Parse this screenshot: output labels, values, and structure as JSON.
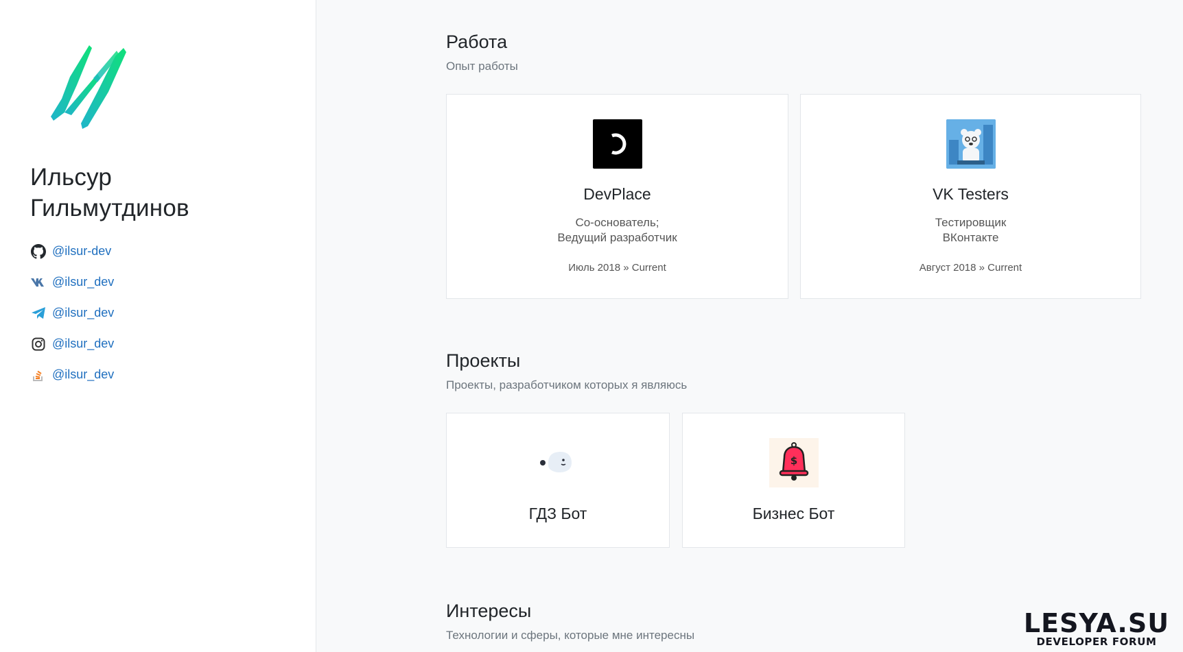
{
  "profile": {
    "logo_icon": "brush-stroke-logo",
    "name_line1": "Ильсур",
    "name_line2": "Гильмутдинов",
    "socials": [
      {
        "icon": "github-icon",
        "handle": "@ilsur-dev"
      },
      {
        "icon": "vk-icon",
        "handle": "@ilsur_dev"
      },
      {
        "icon": "telegram-icon",
        "handle": "@ilsur_dev"
      },
      {
        "icon": "instagram-icon",
        "handle": "@ilsur_dev"
      },
      {
        "icon": "stackoverflow-icon",
        "handle": "@ilsur_dev"
      }
    ]
  },
  "work": {
    "title": "Работа",
    "subtitle": "Опыт работы",
    "items": [
      {
        "name": "DevPlace",
        "role_line1": "Со-основатель;",
        "role_line2": "Ведущий разработчик",
        "dates": "Июль 2018 » Current"
      },
      {
        "name": "VK Testers",
        "role_line1": "Тестировщик",
        "role_line2": "ВКонтакте",
        "dates": "Август 2018 » Current"
      }
    ]
  },
  "projects": {
    "title": "Проекты",
    "subtitle": "Проекты, разработчиком которых я являюсь",
    "items": [
      {
        "name": "ГДЗ Бот"
      },
      {
        "name": "Бизнес Бот"
      }
    ]
  },
  "interests": {
    "title": "Интересы",
    "subtitle": "Технологии и сферы, которые мне интересны"
  },
  "watermark": {
    "line1": "LESYA.SU",
    "line2": "DEVELOPER FORUM"
  },
  "colors": {
    "link": "#1f6fbf",
    "logo_gradient_start": "#1fb5c9",
    "logo_gradient_end": "#10e07a"
  }
}
